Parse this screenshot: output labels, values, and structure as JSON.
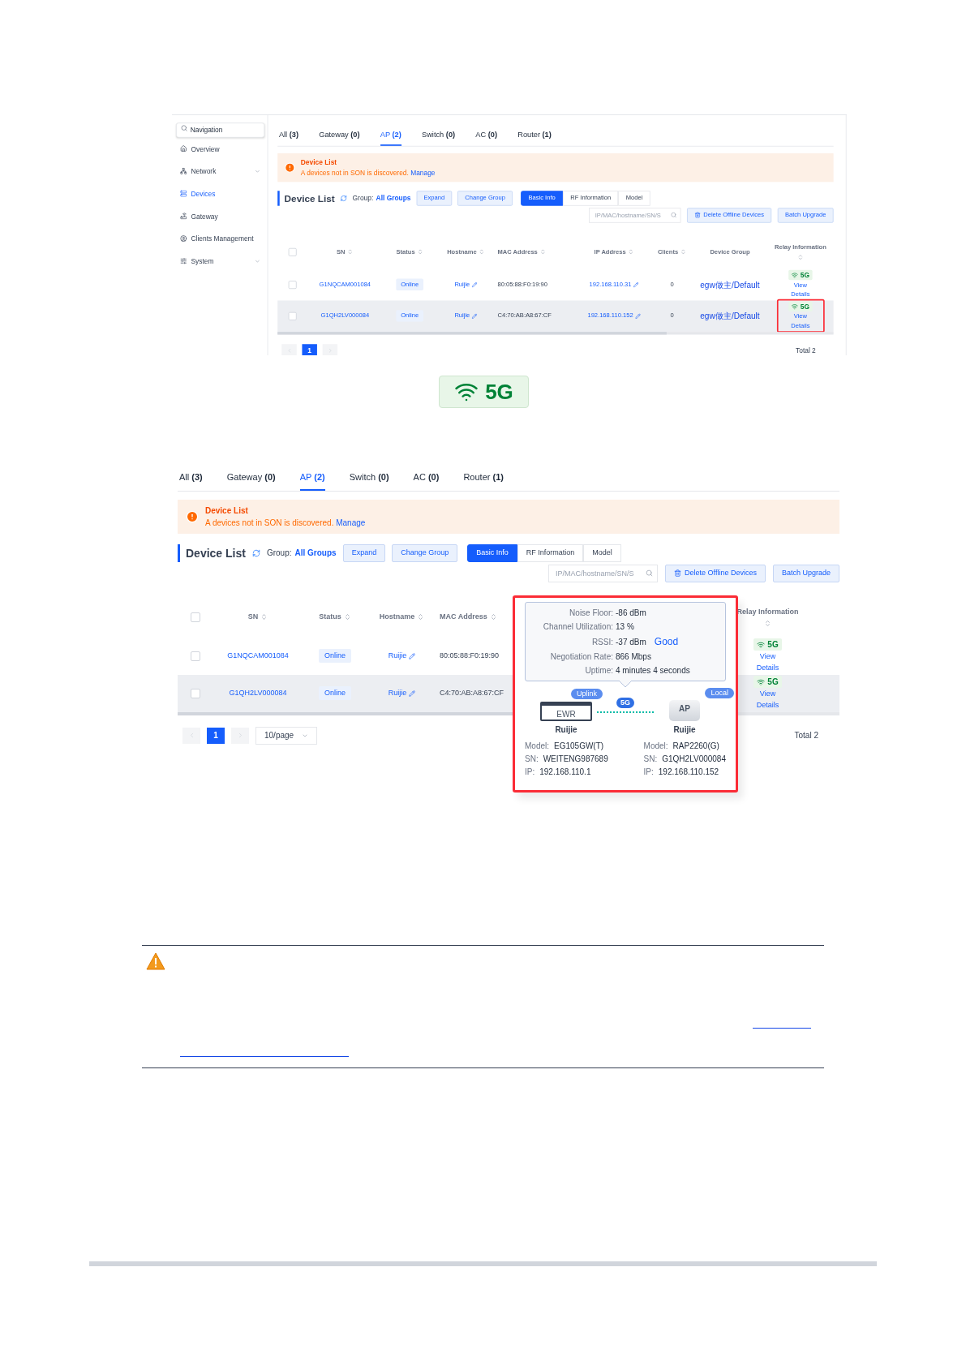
{
  "screens": [
    {
      "sidebar": {
        "search": {
          "placeholder": "Navigation"
        },
        "items": [
          {
            "label": "Overview",
            "selected": false,
            "expandable": false
          },
          {
            "label": "Network",
            "selected": false,
            "expandable": true
          },
          {
            "label": "Devices",
            "selected": true,
            "expandable": false
          },
          {
            "label": "Gateway",
            "selected": false,
            "expandable": false
          },
          {
            "label": "Clients Management",
            "selected": false,
            "expandable": false
          },
          {
            "label": "System",
            "selected": false,
            "expandable": true
          }
        ]
      },
      "tabs": [
        {
          "label": "All",
          "count": "(3)",
          "selected": false
        },
        {
          "label": "Gateway",
          "count": "(0)",
          "selected": false
        },
        {
          "label": "AP",
          "count": "(2)",
          "selected": true
        },
        {
          "label": "Switch",
          "count": "(0)",
          "selected": false
        },
        {
          "label": "AC",
          "count": "(0)",
          "selected": false
        },
        {
          "label": "Router",
          "count": "(1)",
          "selected": false
        }
      ],
      "alert": {
        "title": "Device List",
        "text": "A devices not in SON is discovered.",
        "link": "Manage"
      },
      "header": {
        "title": "Device List",
        "group_label": "Group:",
        "group": "All Groups",
        "buttons": [
          "Expand",
          "Change Group"
        ],
        "views": [
          {
            "label": "Basic Info",
            "selected": true
          },
          {
            "label": "RF Information",
            "selected": false
          },
          {
            "label": "Model",
            "selected": false
          }
        ]
      },
      "search": {
        "placeholder": "IP/MAC/hostname/SN/S"
      },
      "actions": [
        "Delete Offline Devices",
        "Batch Upgrade"
      ],
      "table": {
        "header_checked": false,
        "columns": [
          {
            "kind": "sn",
            "label": "SN",
            "sortable": true
          },
          {
            "kind": "status",
            "label": "Status",
            "sortable": true
          },
          {
            "kind": "hostname",
            "label": "Hostname",
            "sortable": true
          },
          {
            "kind": "mac",
            "label": "MAC Address",
            "sortable": true
          },
          {
            "kind": "ip",
            "label": "IP Address",
            "sortable": true
          },
          {
            "kind": "clients",
            "label": "Clients",
            "sortable": true
          },
          {
            "kind": "group",
            "label": "Device Group",
            "sortable": false
          },
          {
            "kind": "relay",
            "label": "Relay Information",
            "sortable": true
          }
        ],
        "rows": [
          {
            "checked": false,
            "highlighted": false,
            "sn": "G1NQCAM001084",
            "status": "Online",
            "hostname": "Ruijie",
            "mac": "80:05:88:F0:19:90",
            "ip": "192.168.110.31",
            "clients": "0",
            "group": "egw做主/Default",
            "relay": {
              "band": "5G",
              "link": "View Details",
              "marked": false
            }
          },
          {
            "checked": false,
            "highlighted": true,
            "sn": "G1QH2LV000084",
            "status": "Online",
            "hostname": "Ruijie",
            "mac": "C4:70:AB:A8:67:CF",
            "ip": "192.168.110.152",
            "clients": "0",
            "group": "egw做主/Default",
            "relay": {
              "band": "5G",
              "link": "View Details",
              "marked": true
            }
          }
        ]
      },
      "pagination": {
        "page": "1",
        "total": "Total 2"
      }
    },
    {
      "tabs": [
        {
          "label": "All",
          "count": "(3)",
          "selected": false
        },
        {
          "label": "Gateway",
          "count": "(0)",
          "selected": false
        },
        {
          "label": "AP",
          "count": "(2)",
          "selected": true
        },
        {
          "label": "Switch",
          "count": "(0)",
          "selected": false
        },
        {
          "label": "AC",
          "count": "(0)",
          "selected": false
        },
        {
          "label": "Router",
          "count": "(1)",
          "selected": false
        }
      ],
      "alert": {
        "title": "Device List",
        "text": "A devices not in SON is discovered.",
        "link": "Manage"
      },
      "header": {
        "title": "Device List",
        "group_label": "Group:",
        "group": "All Groups",
        "buttons": [
          "Expand",
          "Change Group"
        ],
        "views": [
          {
            "label": "Basic Info",
            "selected": true
          },
          {
            "label": "RF Information",
            "selected": false
          },
          {
            "label": "Model",
            "selected": false
          }
        ]
      },
      "search": {
        "placeholder": "IP/MAC/hostname/SN/S"
      },
      "actions": [
        "Delete Offline Devices",
        "Batch Upgrade"
      ],
      "table": {
        "header_checked": false,
        "columns": [
          {
            "kind": "sn",
            "label": "SN",
            "sortable": true
          },
          {
            "kind": "status",
            "label": "Status",
            "sortable": true
          },
          {
            "kind": "hostname",
            "label": "Hostname",
            "sortable": true
          },
          {
            "kind": "mac",
            "label": "MAC Address",
            "sortable": true
          },
          {
            "kind": "relay",
            "label": "Relay Information",
            "sortable": true
          }
        ],
        "rows": [
          {
            "checked": false,
            "highlighted": false,
            "sn": "G1NQCAM001084",
            "status": "Online",
            "hostname": "Ruijie",
            "mac": "80:05:88:F0:19:90",
            "relay": {
              "band": "5G",
              "link": "View Details",
              "marked": false
            }
          },
          {
            "checked": false,
            "highlighted": true,
            "sn": "G1QH2LV000084",
            "status": "Online",
            "hostname": "Ruijie",
            "mac": "C4:70:AB:A8:67:CF",
            "relay": {
              "band": "5G",
              "link": "View Details",
              "marked": false
            }
          }
        ],
        "popover": {
          "stats": [
            {
              "label": "Noise Floor:",
              "value": "-86 dBm"
            },
            {
              "label": "Channel Utilization:",
              "value": "13 %"
            },
            {
              "label": "RSSI:",
              "value": "-37 dBm",
              "quality": "Good"
            },
            {
              "label": "Negotiation Rate:",
              "value": "866 Mbps"
            },
            {
              "label": "Uptime:",
              "value": "4 minutes 4 seconds"
            }
          ],
          "band": "5G",
          "devices": [
            {
              "kind": "router",
              "tag": "Uplink",
              "box_label": "EWR",
              "name": "Ruijie",
              "fields": [
                {
                  "label": "Model:",
                  "value": "EG105GW(T)"
                },
                {
                  "label": "SN:",
                  "value": "WEITENG987689"
                },
                {
                  "label": "IP:",
                  "value": "192.168.110.1"
                }
              ]
            },
            {
              "kind": "ap",
              "tag": "Local",
              "box_label": "AP",
              "name": "Ruijie",
              "fields": [
                {
                  "label": "Model:",
                  "value": "RAP2260(G)"
                },
                {
                  "label": "SN:",
                  "value": "G1QH2LV000084"
                },
                {
                  "label": "IP:",
                  "value": "192.168.110.152"
                }
              ]
            }
          ]
        }
      },
      "pagination": {
        "page": "1",
        "page_size": "10/page",
        "total": "Total 2"
      }
    }
  ],
  "zoomed_badge": {
    "band": "5G"
  },
  "note": {
    "kind": "warning"
  }
}
